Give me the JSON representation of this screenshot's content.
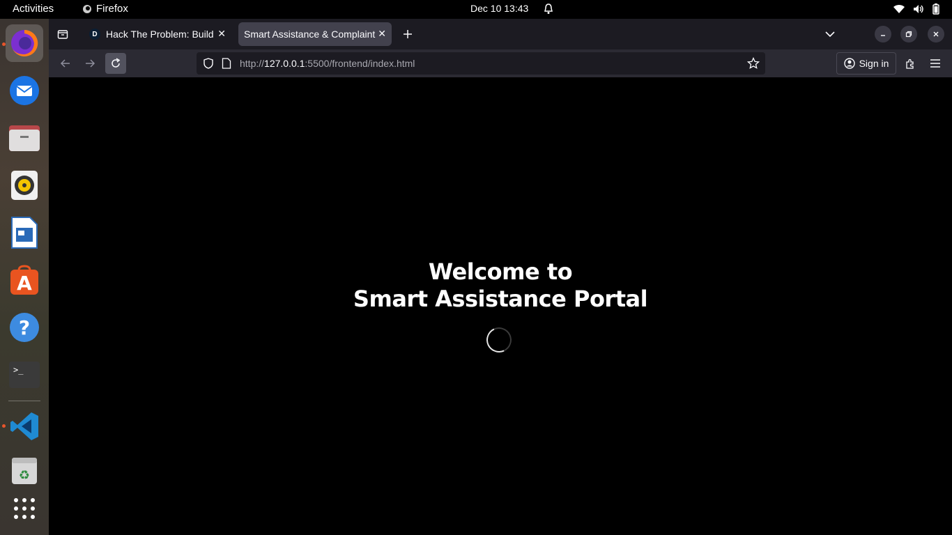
{
  "topbar": {
    "activities": "Activities",
    "app_name": "Firefox",
    "clock": "Dec 10  13:43"
  },
  "dock": {
    "items": [
      "firefox-icon",
      "thunderbird-icon",
      "files-icon",
      "rhythmbox-icon",
      "writer-icon",
      "app-center-icon",
      "help-icon",
      "terminal-icon",
      "vscode-icon",
      "trash-icon",
      "app-grid-icon"
    ]
  },
  "browser": {
    "tabs": [
      {
        "label": "Hack The Problem: Build",
        "favicon": "D"
      },
      {
        "label": "Smart Assistance & Complaint",
        "active": true
      }
    ],
    "url_prefix": "http://",
    "url_host": "127.0.0.1",
    "url_rest": ":5500/frontend/index.html",
    "signin": "Sign in"
  },
  "page": {
    "welcome_line1": "Welcome to",
    "welcome_line2": "Smart Assistance Portal",
    "loading": true
  },
  "colors": {
    "background": "#000000",
    "tabstrip": "#1c1b22",
    "navbar": "#2b2a33",
    "active_tab": "#42414d",
    "dock_indicator": "#e8552b"
  }
}
